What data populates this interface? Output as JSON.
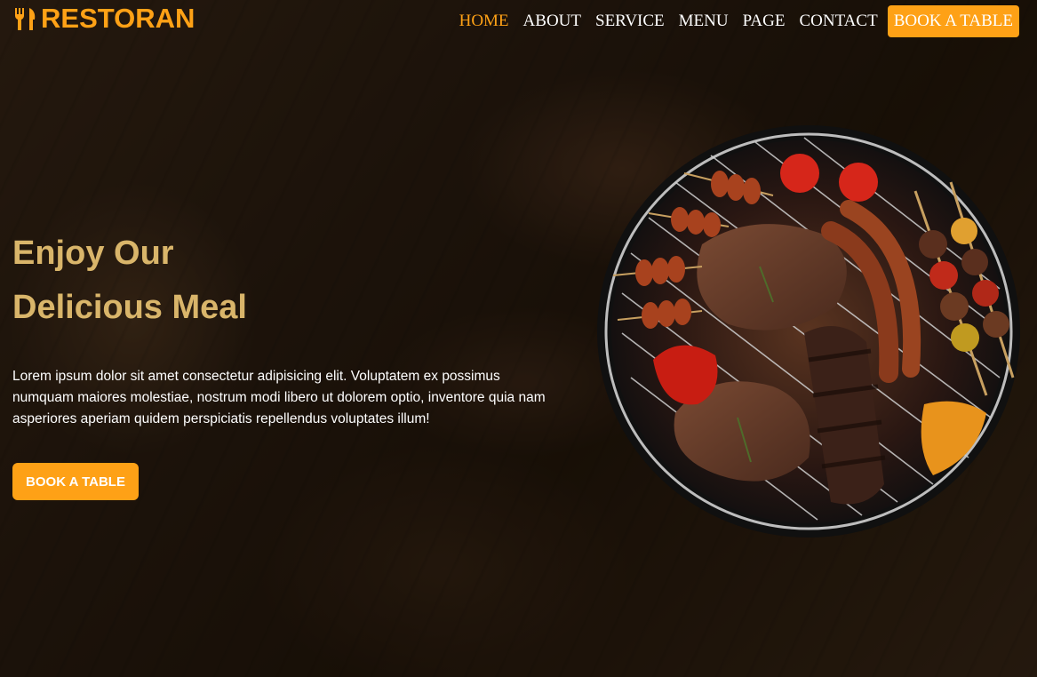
{
  "brand": {
    "name": "RESTORAN",
    "icon": "fork-knife-icon",
    "color": "#FEA116"
  },
  "nav": {
    "items": [
      {
        "label": "HOME",
        "active": true
      },
      {
        "label": "ABOUT",
        "active": false
      },
      {
        "label": "SERVICE",
        "active": false
      },
      {
        "label": "MENU",
        "active": false
      },
      {
        "label": "PAGE",
        "active": false
      },
      {
        "label": "CONTACT",
        "active": false
      }
    ],
    "cta": "BOOK A TABLE"
  },
  "hero": {
    "title_line1": "Enjoy Our",
    "title_line2": "Delicious Meal",
    "description": "Lorem ipsum dolor sit amet consectetur adipisicing elit. Voluptatem ex possimus numquam maiores molestiae, nostrum modi libero ut dolorem optio, inventore quia nam asperiores aperiam quidem perspiciatis repellendus voluptates illum!",
    "button": "BOOK A TABLE",
    "image": "bbq-grill-image"
  },
  "colors": {
    "accent": "#FEA116",
    "title": "#D9B56A",
    "text": "#FFFFFF"
  }
}
